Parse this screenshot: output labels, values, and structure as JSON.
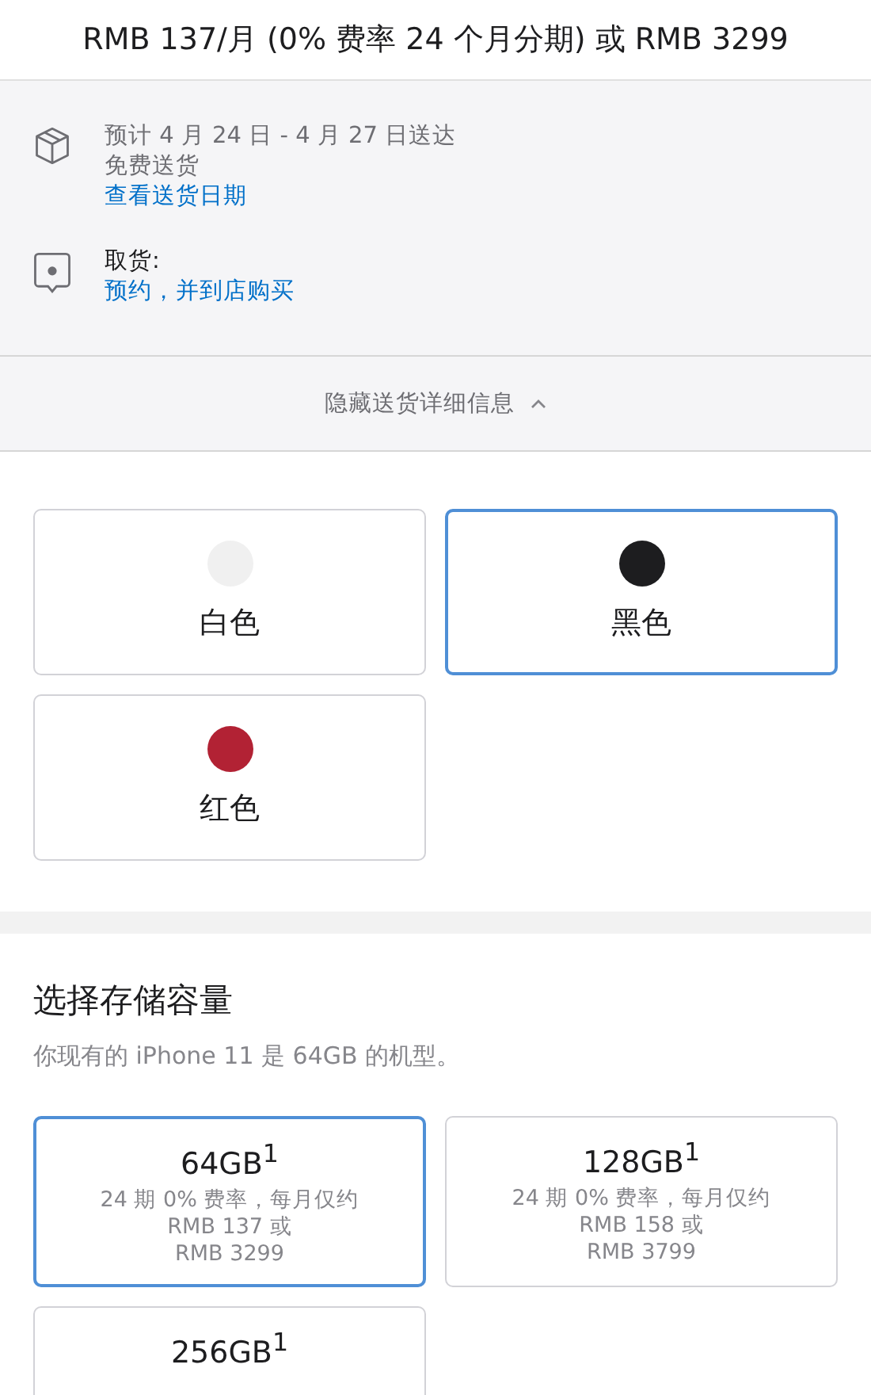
{
  "price_line": "RMB 137/月 (0% 费率 24 个月分期) 或 RMB 3299",
  "delivery": {
    "estimate": "预计 4 月 24 日 - 4 月 27 日送达",
    "shipping": "免费送货",
    "link": "查看送货日期"
  },
  "pickup": {
    "label": "取货:",
    "link": "预约，并到店购买"
  },
  "toggle": {
    "label": "隐藏送货详细信息",
    "expanded": true
  },
  "colors": [
    {
      "name": "白色",
      "color": "#f0f0f0",
      "selected": false
    },
    {
      "name": "黑色",
      "color": "#1d1d1f",
      "selected": true
    },
    {
      "name": "红色",
      "color": "#b22234",
      "selected": false
    }
  ],
  "storage": {
    "title": "选择存储容量",
    "note": "你现有的 iPhone 11 是 64GB 的机型。",
    "options": [
      {
        "size": "64GB$^{1}$",
        "lines": [
          "24 期 0% 费率，每月仅约",
          "RMB 137 或",
          "RMB 3299"
        ],
        "selected": true
      },
      {
        "size": "128GB$^{1}$",
        "lines": [
          "24 期 0% 费率，每月仅约",
          "RMB 158 或",
          "RMB 3799"
        ],
        "selected": false
      },
      {
        "size": "256GB$^{1}$",
        "selected": false
      }
    ]
  }
}
